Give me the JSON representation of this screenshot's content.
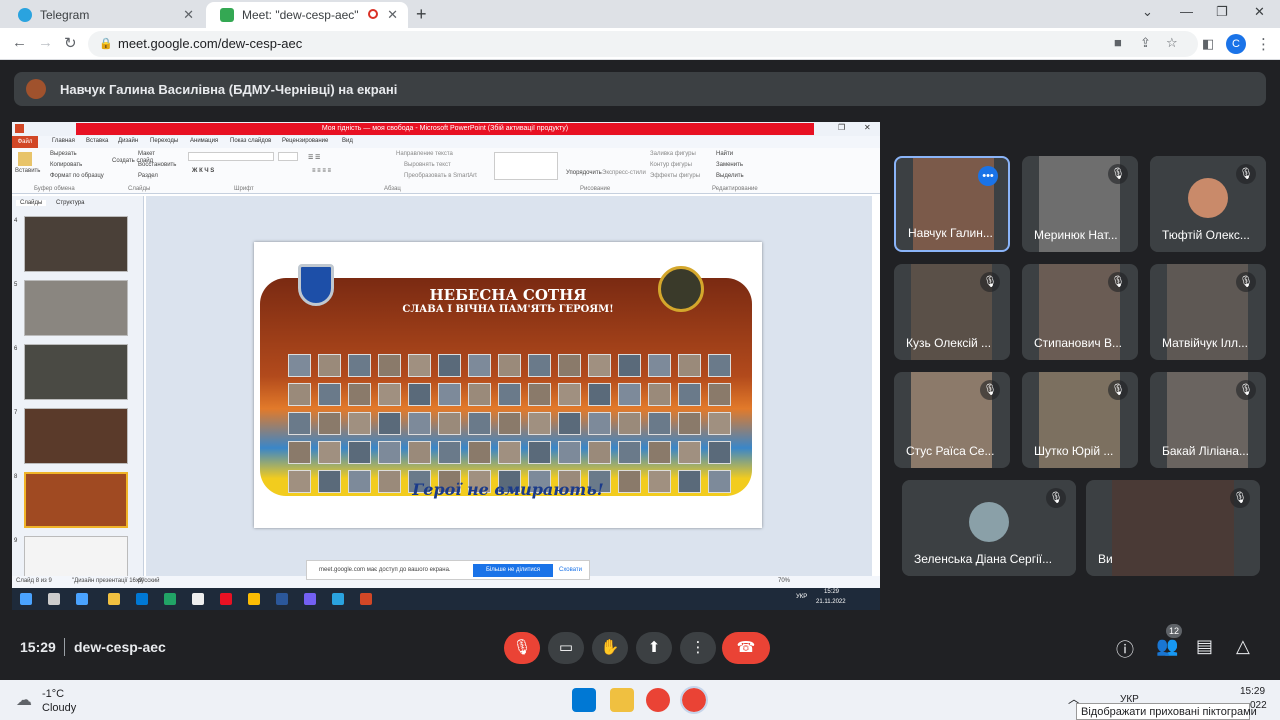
{
  "browser": {
    "tabs": [
      {
        "label": "Telegram"
      },
      {
        "label": "Meet: \"dew-cesp-aec\""
      }
    ],
    "url": "meet.google.com/dew-cesp-aec",
    "profile_initial": "C"
  },
  "presenter_bar": {
    "text": "Навчук Галина Василівна (БДМУ-Чернівці) на екрані"
  },
  "shared_screen": {
    "app_title": "Моя гідність — моя свобода - Microsoft PowerPoint (Збій активації продукту)",
    "ribbon_tabs": [
      "Файл",
      "Главная",
      "Вставка",
      "Дизайн",
      "Переходы",
      "Анимация",
      "Показ слайдов",
      "Рецензирование",
      "Вид"
    ],
    "ribbon_items": {
      "paste": "Вставить",
      "cut": "Вырезать",
      "copy": "Копировать",
      "format_painter": "Формат по образцу",
      "new_slide": "Создать слайд",
      "layout": "Макет",
      "reset": "Восстановить",
      "section": "Раздел",
      "clipboard_group": "Буфер обмена",
      "slides_group": "Слайды",
      "font_group": "Шрифт",
      "paragraph_group": "Абзац",
      "drawing_group": "Рисование",
      "editing_group": "Редактирование",
      "text_direction": "Направление текста",
      "align_text": "Выровнять текст",
      "smartart": "Преобразовать в SmartArt",
      "arrange": "Упорядочить",
      "quick_styles": "Экспресс-стили",
      "shape_fill": "Заливка фигуры",
      "shape_outline": "Контур фигуры",
      "shape_effects": "Эффекты фигуры",
      "find": "Найти",
      "replace": "Заменить",
      "select": "Выделить"
    },
    "pane_tabs": [
      "Слайды",
      "Структура"
    ],
    "thumbnail_numbers": [
      "4",
      "5",
      "6",
      "7",
      "8",
      "9"
    ],
    "slide": {
      "title": "НЕБЕСНА СОТНЯ",
      "subtitle": "СЛАВА І ВІЧНА ПАМ'ЯТЬ ГЕРОЯМ!",
      "footer": "Герої не вмирають!",
      "colors": {
        "blue": "#1d4fa8",
        "yellow": "#f2cc1e",
        "frame": "#7a2a12"
      }
    },
    "status": {
      "slide": "Слайд 8 из 9",
      "theme": "\"Дизайн презентації 16х9\"",
      "lang": "русский",
      "zoom": "70%"
    },
    "share_notice": {
      "text": "meet.google.com має доступ до вашого екрана.",
      "stop": "Більше не ділитися",
      "hide": "Сховати"
    },
    "taskbar": {
      "lang": "УКР",
      "time": "15:29",
      "date": "21.11.2022"
    }
  },
  "participants": [
    {
      "name": "Навчук Галин...",
      "bg": "#7b5a4a",
      "muted": false,
      "speaking_menu": true
    },
    {
      "name": "Меринюк Нат...",
      "bg": "#6e6e6e",
      "muted": true
    },
    {
      "name": "Тюфтій Олекс...",
      "bg": "#3c4043",
      "muted": true,
      "avatar_color": "#c98a6a"
    },
    {
      "name": "Кузь Олексій ...",
      "bg": "#5a5048",
      "muted": true
    },
    {
      "name": "Стипанович В...",
      "bg": "#6a5c54",
      "muted": true
    },
    {
      "name": "Матвійчук Ілл...",
      "bg": "#5e5854",
      "muted": true
    },
    {
      "name": "Стус Раїса Се...",
      "bg": "#8c7a6a",
      "muted": true
    },
    {
      "name": "Шутко Юрій ...",
      "bg": "#7c7060",
      "muted": true
    },
    {
      "name": "Бакай Ліліана...",
      "bg": "#6a6460",
      "muted": true
    },
    {
      "name": "Зеленська Діана Сергії...",
      "bg": "#3c4043",
      "muted": true,
      "avatar_color": "#8aa0a8"
    },
    {
      "name": "Ви",
      "bg": "#4a3a36",
      "muted": true
    }
  ],
  "meeting_bar": {
    "time": "15:29",
    "code": "dew-cesp-aec",
    "participant_count": "12"
  },
  "os_taskbar": {
    "weather_temp": "-1°C",
    "weather_desc": "Cloudy",
    "lang": "УКР",
    "time": "15:29",
    "date_partial": "022",
    "tooltip": "Відображати приховані піктограми"
  }
}
